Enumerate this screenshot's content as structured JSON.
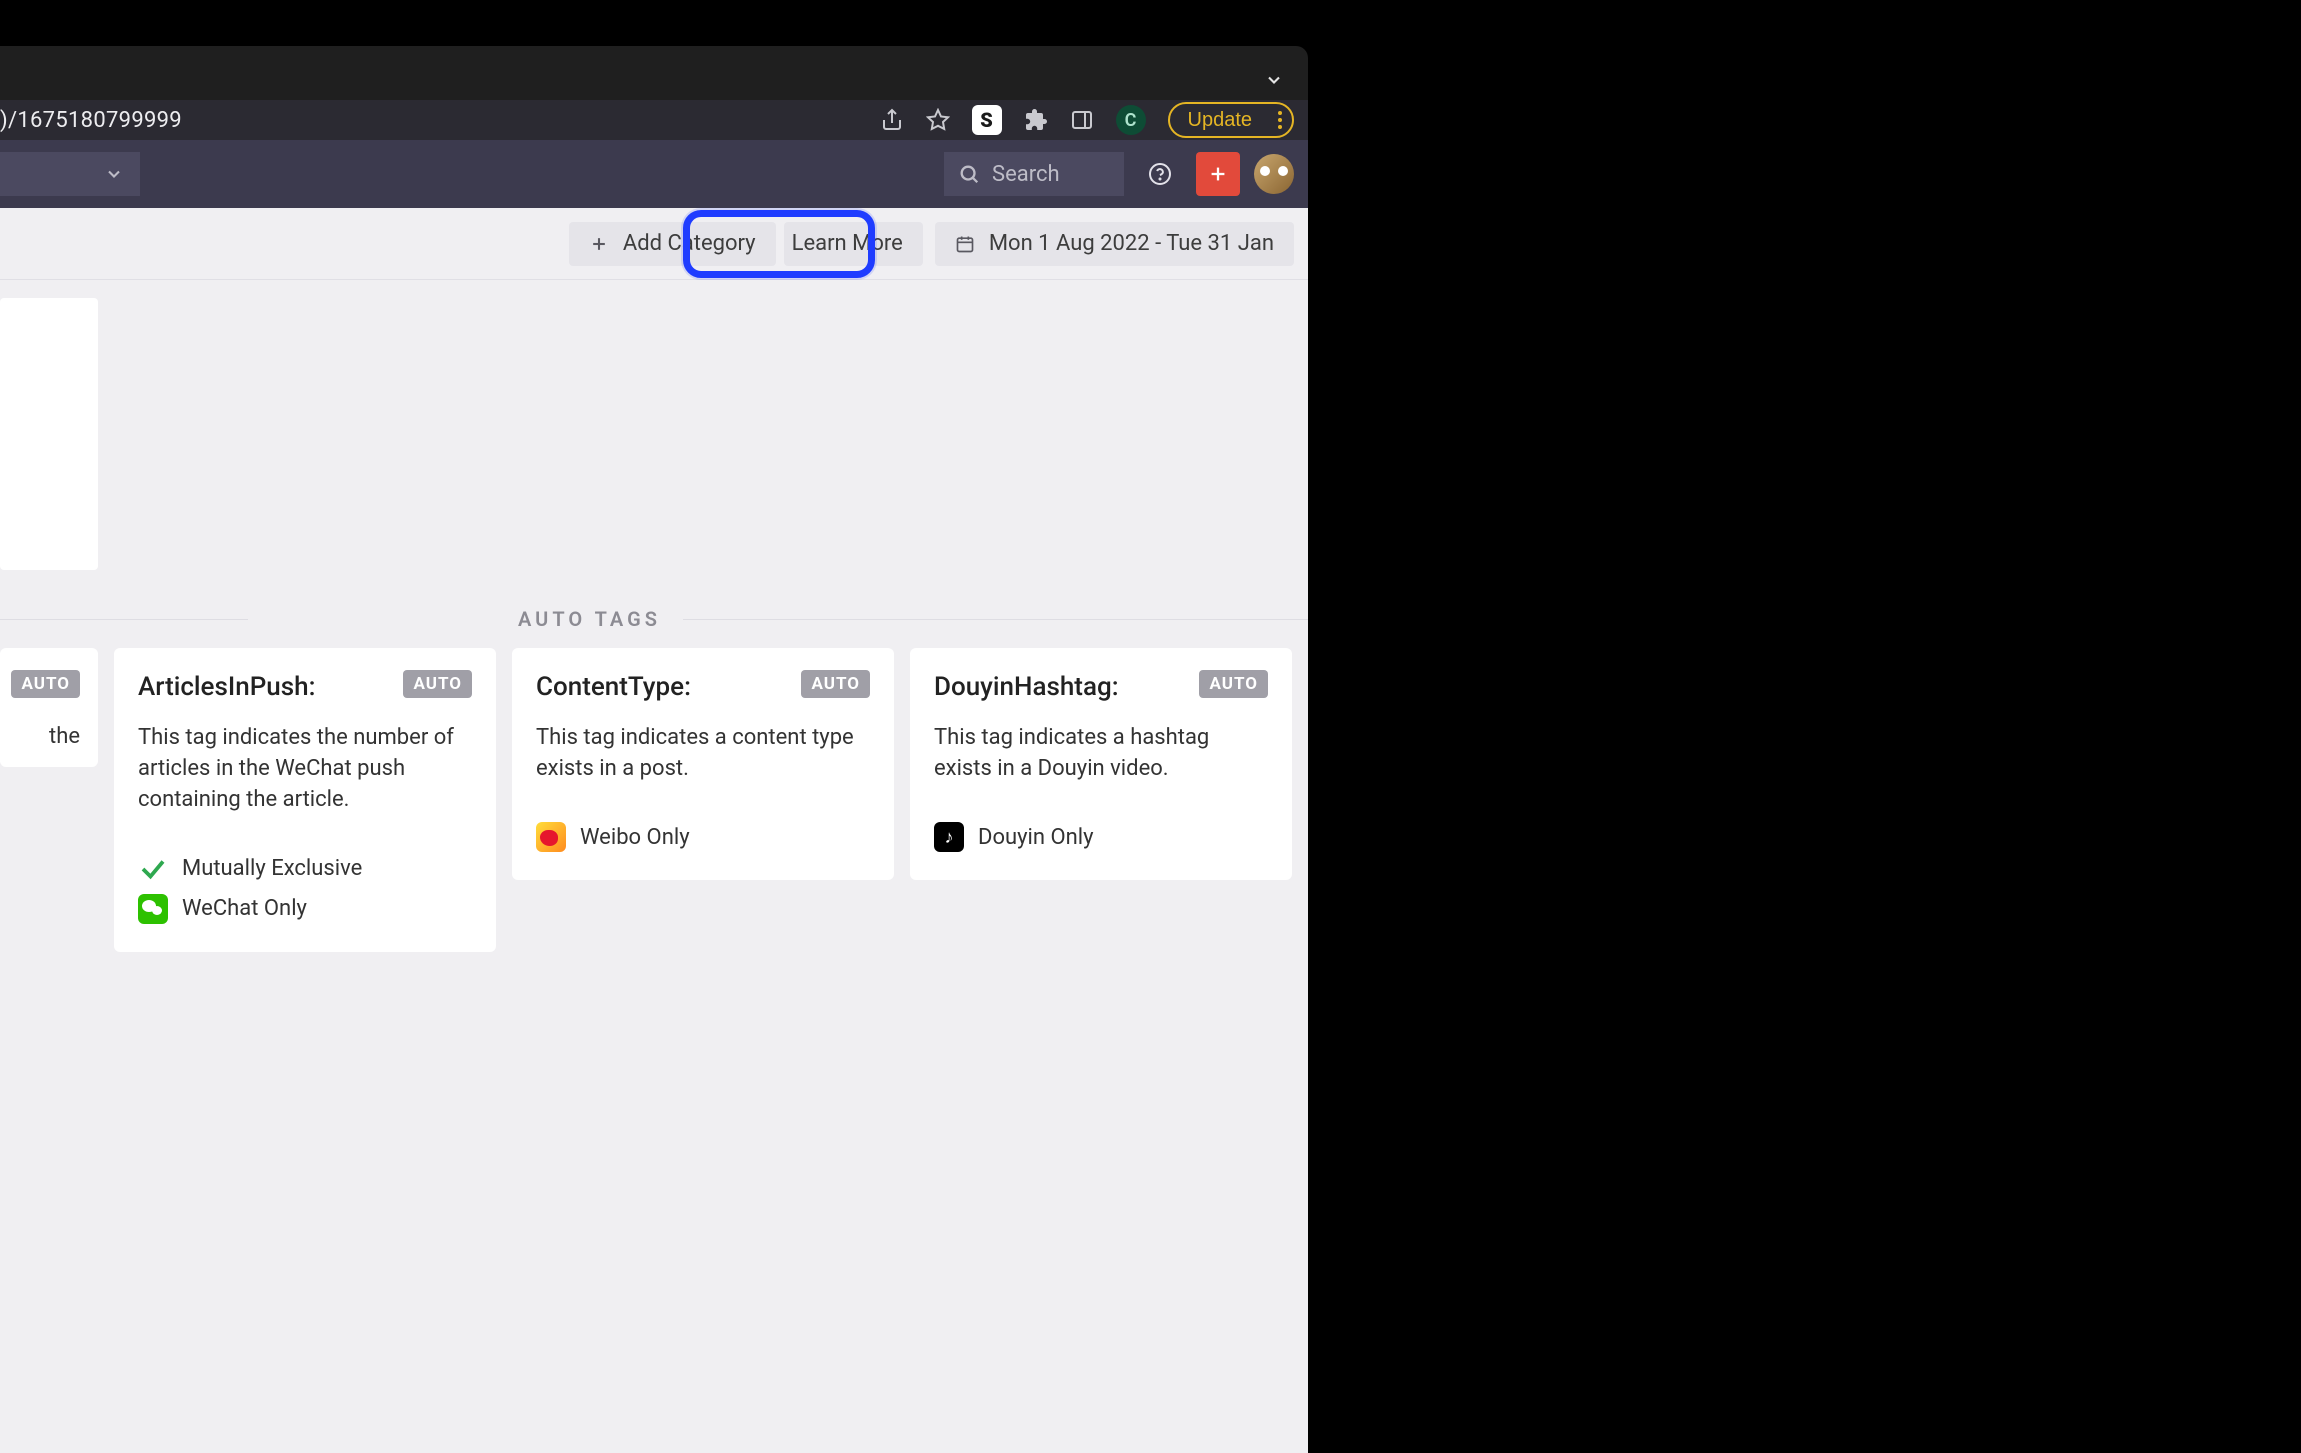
{
  "browser": {
    "url_fragment": ")/1675180799999",
    "update_label": "Update",
    "ext_s_letter": "S",
    "ext_c_letter": "C"
  },
  "header": {
    "search_placeholder": "Search"
  },
  "toolbar": {
    "add_category_label": "Add Category",
    "learn_more_label": "Learn More",
    "date_range_label": "Mon 1 Aug 2022 - Tue 31 Jan"
  },
  "section": {
    "auto_tags_label": "AUTO TAGS"
  },
  "badges": {
    "auto": "AUTO"
  },
  "cards": {
    "partial_left": {
      "desc_fragment": "the"
    },
    "articles_in_push": {
      "title": "ArticlesInPush:",
      "desc": "This tag indicates the number of articles in the WeChat push containing the article.",
      "meta1": "Mutually Exclusive",
      "meta2": "WeChat Only"
    },
    "content_type": {
      "title": "ContentType:",
      "desc": "This tag indicates a content type exists in a post.",
      "meta1": "Weibo Only"
    },
    "douyin_hashtag": {
      "title": "DouyinHashtag:",
      "desc": "This tag indicates a hashtag exists in a Douyin video.",
      "meta1": "Douyin Only"
    }
  }
}
